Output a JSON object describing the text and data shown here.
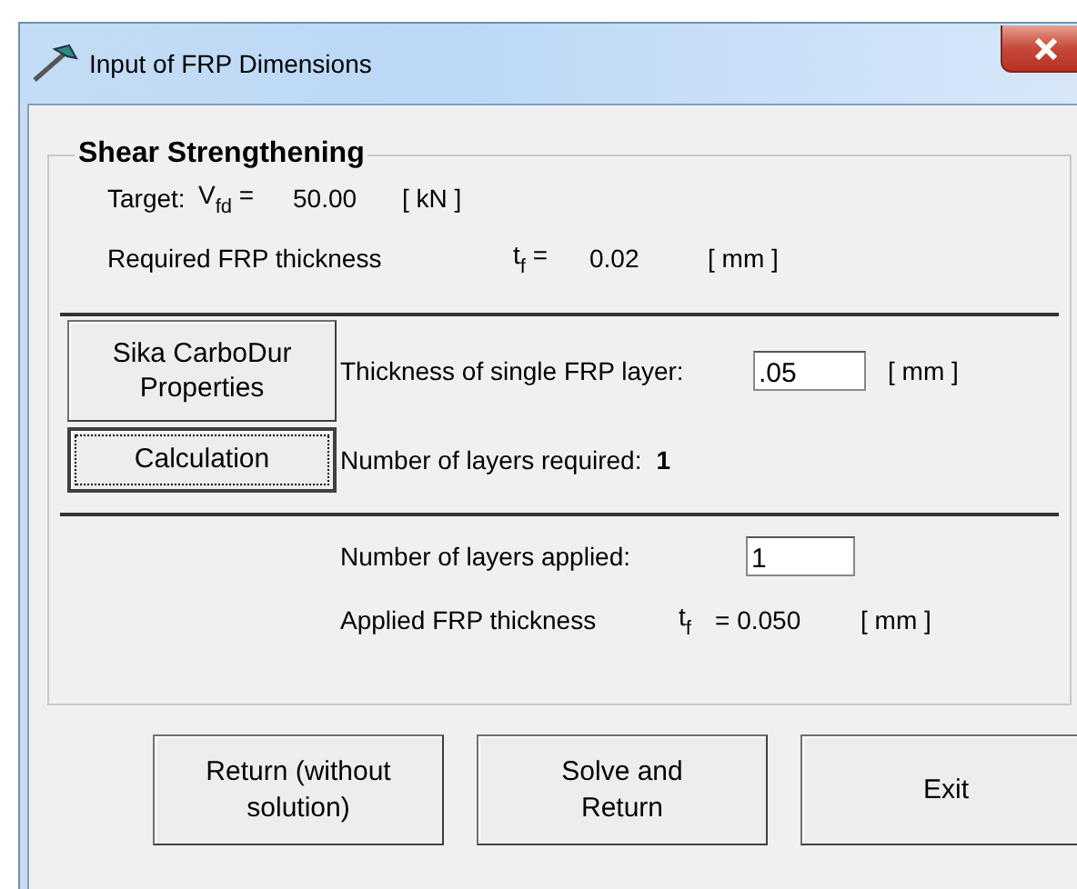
{
  "window": {
    "title": "Input of FRP Dimensions"
  },
  "group": {
    "title": "Shear Strengthening",
    "target": {
      "label": "Target:",
      "symbol": "V$_{fd}$  =",
      "value": "50.00",
      "unit": "[ kN ]"
    },
    "required": {
      "label": "Required FRP thickness",
      "symbol": "t$_{f}$ =",
      "value": "0.02",
      "unit": "[ mm ]"
    },
    "properties_button": {
      "label": "Sika CarboDur Properties",
      "focused": false
    },
    "single_layer": {
      "label": "Thickness of single FRP layer:",
      "value": ".05",
      "unit": "[ mm ]"
    },
    "calculation_button": {
      "label": "Calculation",
      "focused": true
    },
    "layers_required": {
      "label": "Number of layers required:",
      "value": "1"
    },
    "layers_applied": {
      "label": "Number of layers applied:",
      "value": "1"
    },
    "applied": {
      "label": "Applied FRP thickness",
      "symbol": "t$_{f}$",
      "value": "= 0.050",
      "unit": "[ mm ]"
    }
  },
  "buttons": [
    {
      "label": "Return (without solution)"
    },
    {
      "label": "Solve and Return"
    },
    {
      "label": "Exit"
    }
  ]
}
